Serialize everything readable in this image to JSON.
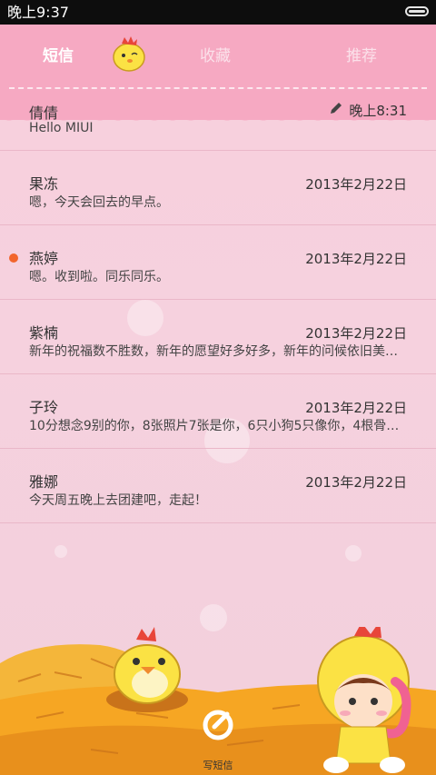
{
  "status_bar": {
    "time": "晚上9:37"
  },
  "tabs": [
    {
      "label": "短信",
      "active": true
    },
    {
      "label": "收藏",
      "active": false
    },
    {
      "label": "推荐",
      "active": false
    }
  ],
  "conversations": [
    {
      "name": "倩倩",
      "preview": "Hello MIUI",
      "date": "晚上8:31",
      "draft": true,
      "unread": false
    },
    {
      "name": "果冻",
      "preview": "嗯，今天会回去的早点。",
      "date": "2013年2月22日",
      "unread": false
    },
    {
      "name": "燕婷",
      "preview": "嗯。收到啦。同乐同乐。",
      "date": "2013年2月22日",
      "unread": true
    },
    {
      "name": "紫楠",
      "preview": "新年的祝福数不胜数，新年的愿望好多好多，新年的问候依旧美好…",
      "date": "2013年2月22日",
      "unread": false
    },
    {
      "name": "子玲",
      "preview": "10分想念9别的你，8张照片7张是你，6只小狗5只像你，4根骨头…",
      "date": "2013年2月22日",
      "unread": false
    },
    {
      "name": "雅娜",
      "preview": "今天周五晚上去团建吧，走起！",
      "date": "2013年2月22日",
      "unread": false
    }
  ],
  "compose": {
    "label": "写短信"
  },
  "colors": {
    "header": "#f6a9c2",
    "unread": "#f2652c",
    "background": "#f6d1de"
  }
}
